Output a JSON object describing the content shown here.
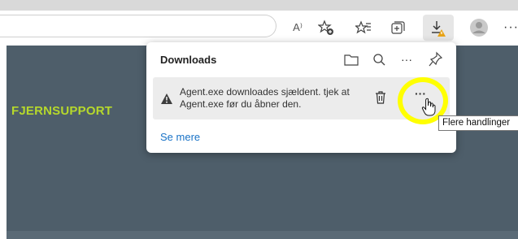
{
  "toolbar": {
    "read_aloud_label": "A⁾",
    "more_label": "···"
  },
  "page": {
    "brand": "FJERNSUPPORT"
  },
  "downloads": {
    "title": "Downloads",
    "more_options_label": "···",
    "item": {
      "warning_line1": "Agent.exe downloades sjældent. tjek at",
      "warning_line2": "Agent.exe før du åbner den.",
      "more_actions_label": "···"
    },
    "see_more": "Se mere"
  },
  "tooltip": {
    "text": "Flere handlinger"
  },
  "colors": {
    "page_bg": "#4e5e6a",
    "brand": "#b6d82c",
    "link": "#1a73c7",
    "highlight": "#ffff00",
    "warning": "#e8a317"
  }
}
